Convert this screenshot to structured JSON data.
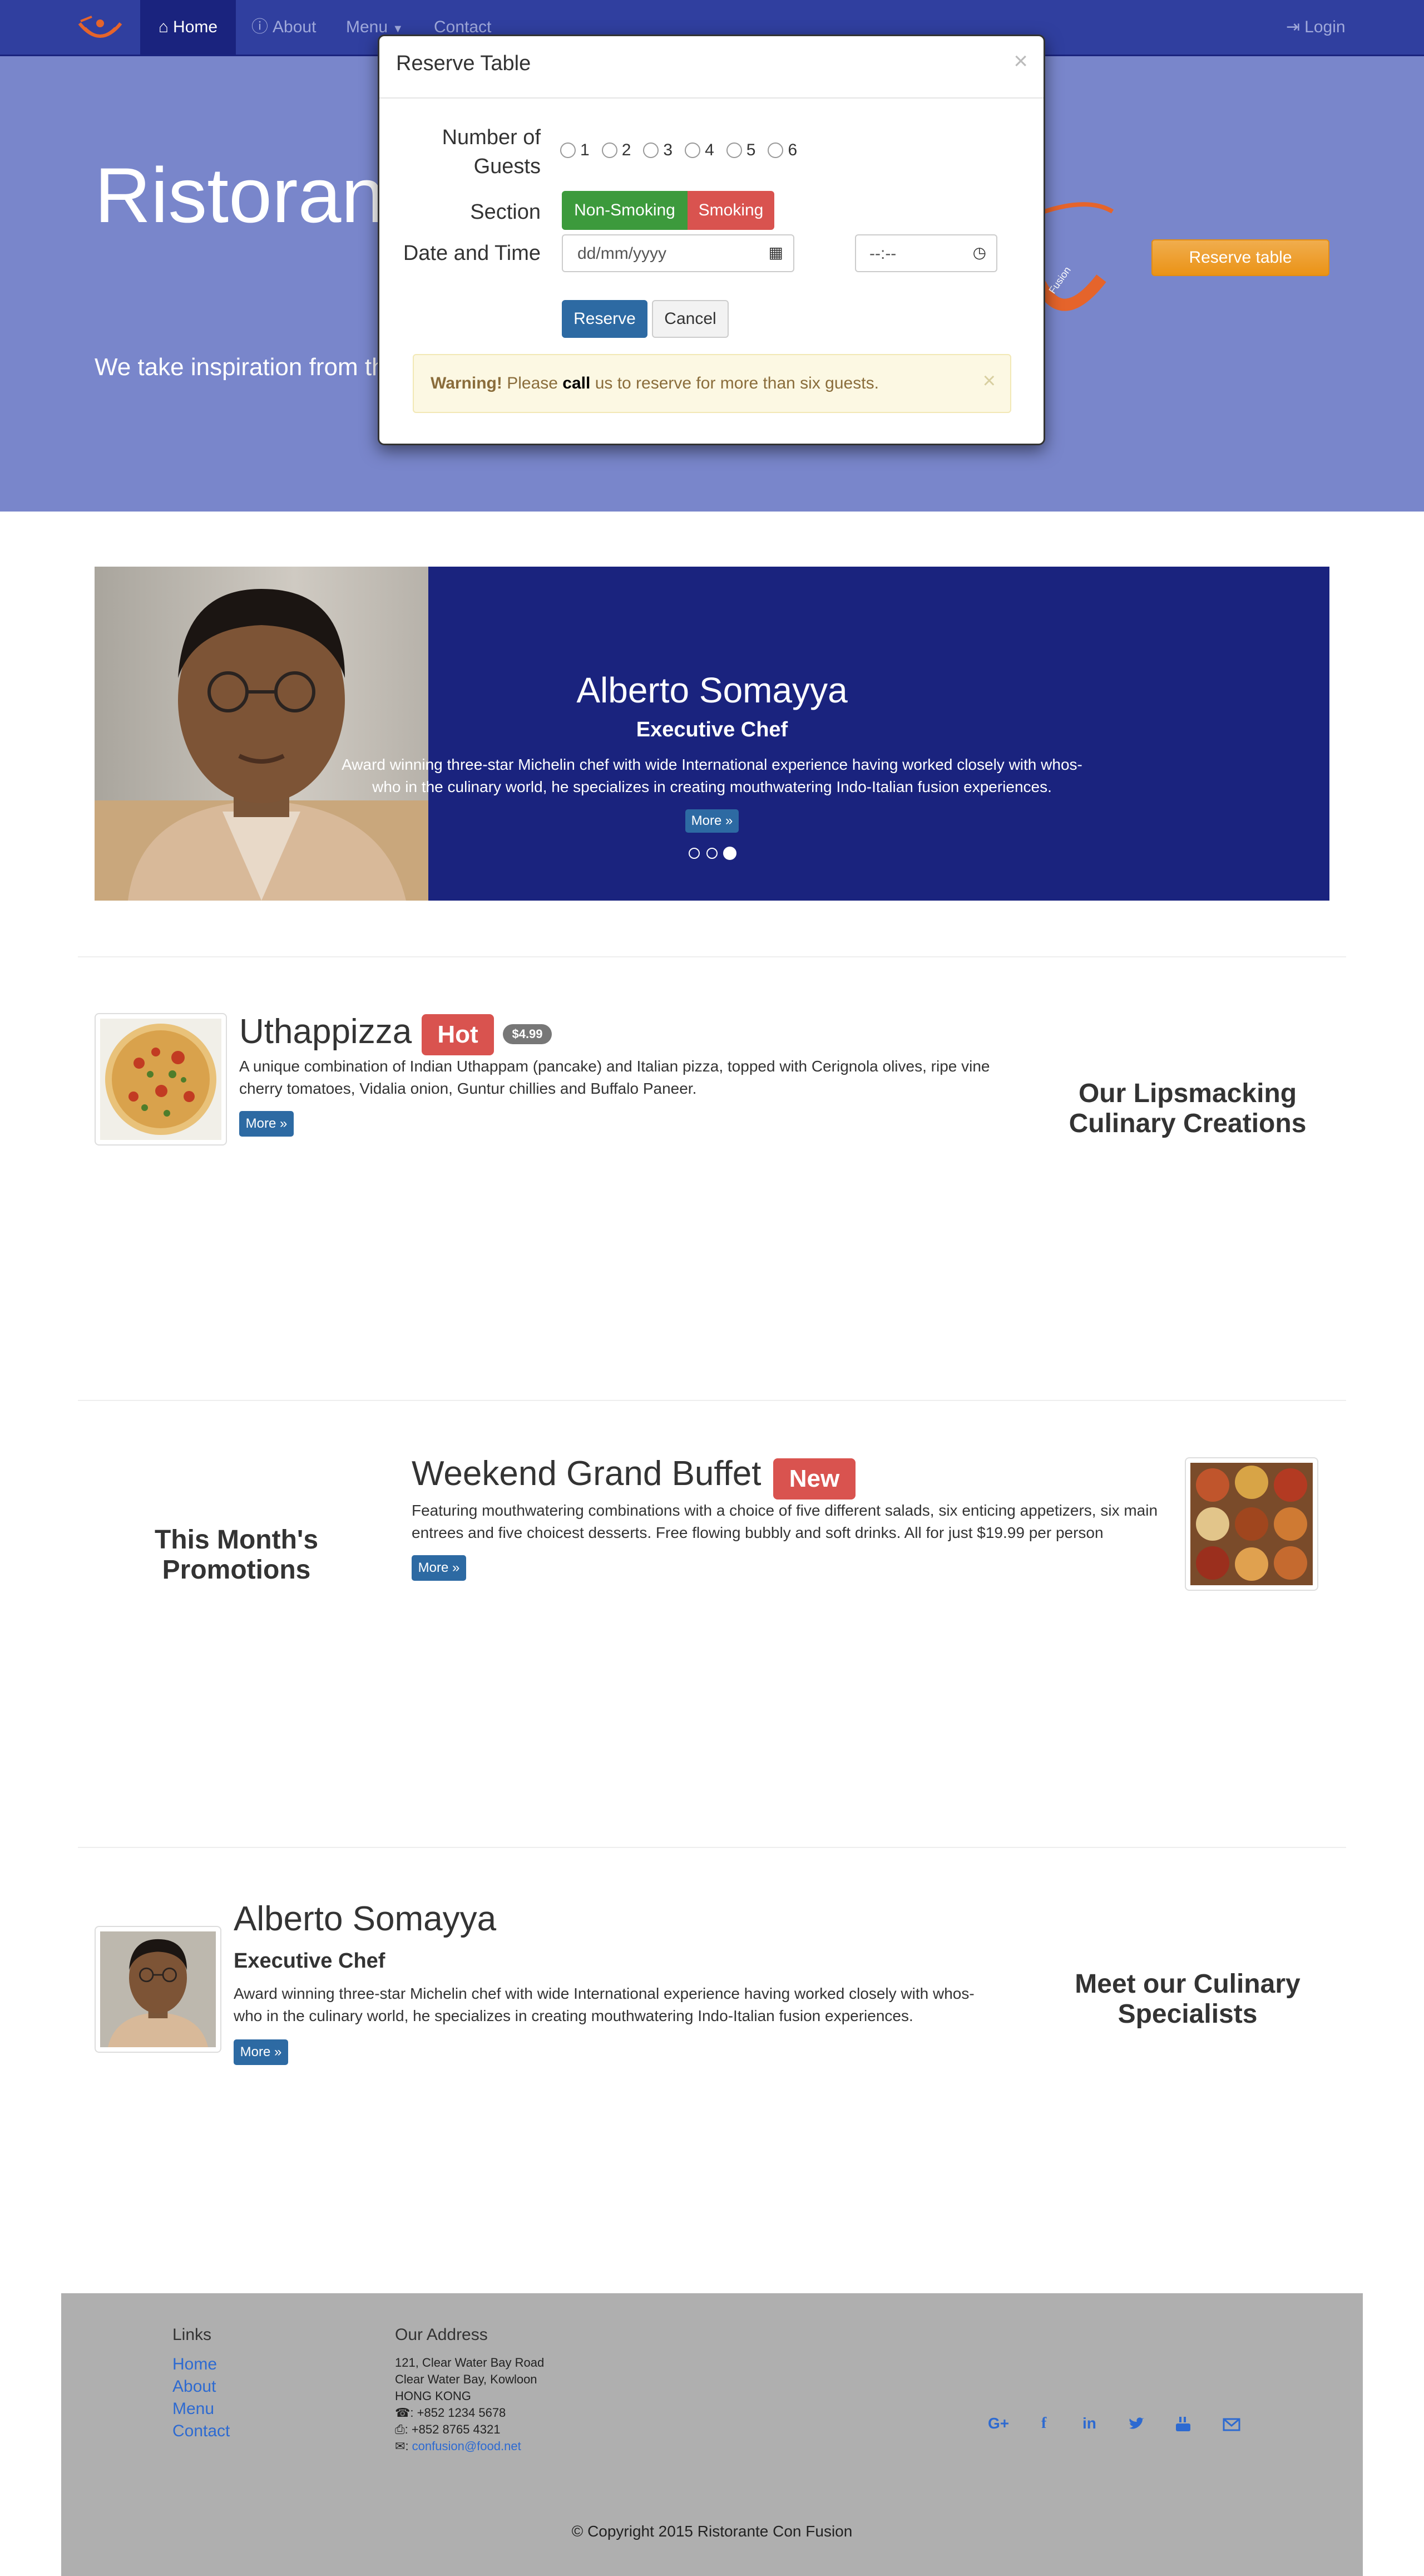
{
  "navbar": {
    "brand_logo": "con-fusion-logo",
    "items": [
      {
        "label": "Home",
        "icon": "home-icon",
        "active": true
      },
      {
        "label": "About",
        "icon": "info-icon",
        "active": false
      },
      {
        "label": "Menu",
        "icon": "caret-down-icon",
        "active": false
      },
      {
        "label": "Contact",
        "icon": "",
        "active": false
      }
    ],
    "login": {
      "label": "Login",
      "icon": "login-icon"
    }
  },
  "jumbotron": {
    "title": "Ristorante con Fusion",
    "text": "We take inspiration from the World's best cuisines, and create a unique fusion experience. Our lipsmacking creations will tickle your culinary senses!",
    "logo_text": "Fusion",
    "reserve_button": "Reserve table"
  },
  "modal": {
    "title": "Reserve Table",
    "close": "×",
    "guests_label": "Number of Guests",
    "guest_options": [
      "1",
      "2",
      "3",
      "4",
      "5",
      "6"
    ],
    "section_label": "Section",
    "section_options": [
      "Non-Smoking",
      "Smoking"
    ],
    "datetime_label": "Date and Time",
    "date_placeholder": "dd/mm/yyyy",
    "time_placeholder": "--:--",
    "reserve_button": "Reserve",
    "cancel_button": "Cancel",
    "warning": {
      "strong": "Warning!",
      "text1": "Please",
      "bold": "call",
      "text2": "us to reserve for more than six guests.",
      "close": "×"
    }
  },
  "carousel": {
    "name": "Alberto Somayya",
    "designation": "Executive Chef",
    "description": "Award winning three-star Michelin chef with wide International experience having worked closely with whos-who in the culinary world, he specializes in creating mouthwatering Indo-Italian fusion experiences.",
    "more": "More »",
    "active_index": 2,
    "slide_count": 3
  },
  "dish": {
    "name": "Uthappizza",
    "label": "Hot",
    "price": "$4.99",
    "description": "A unique combination of Indian Uthappam (pancake) and Italian pizza, topped with Cerignola olives, ripe vine cherry tomatoes, Vidalia onion, Guntur chillies and Buffalo Paneer.",
    "more": "More »",
    "side_title": "Our Lipsmacking Culinary Creations"
  },
  "promotion": {
    "name": "Weekend Grand Buffet",
    "label": "New",
    "description": "Featuring mouthwatering combinations with a choice of five different salads, six enticing appetizers, six main entrees and five choicest desserts. Free flowing bubbly and soft drinks. All for just $19.99 per person",
    "more": "More »",
    "side_title": "This Month's Promotions"
  },
  "leader": {
    "name": "Alberto Somayya",
    "designation": "Executive Chef",
    "description": "Award winning three-star Michelin chef with wide International experience having worked closely with whos-who in the culinary world, he specializes in creating mouthwatering Indo-Italian fusion experiences.",
    "more": "More »",
    "side_title": "Meet our Culinary Specialists"
  },
  "footer": {
    "links_title": "Links",
    "links": [
      "Home",
      "About",
      "Menu",
      "Contact"
    ],
    "address_title": "Our Address",
    "address_lines": [
      "121, Clear Water Bay Road",
      "Clear Water Bay, Kowloon",
      "HONG KONG"
    ],
    "phone": ": +852 1234 5678",
    "fax": ": +852 8765 4321",
    "email": "confusion@food.net",
    "social": [
      "G+",
      "f",
      "in",
      "twitter",
      "youtube",
      "mail"
    ],
    "copyright": "© Copyright 2015 Ristorante Con Fusion"
  },
  "colors": {
    "primary": "#303f9f",
    "primary_dark": "#1a237e",
    "primary_light": "#7986cb",
    "accent": "#f0ad4e",
    "danger": "#d9534f",
    "success": "#3c9a3c",
    "footer_bg": "#afafaf"
  }
}
